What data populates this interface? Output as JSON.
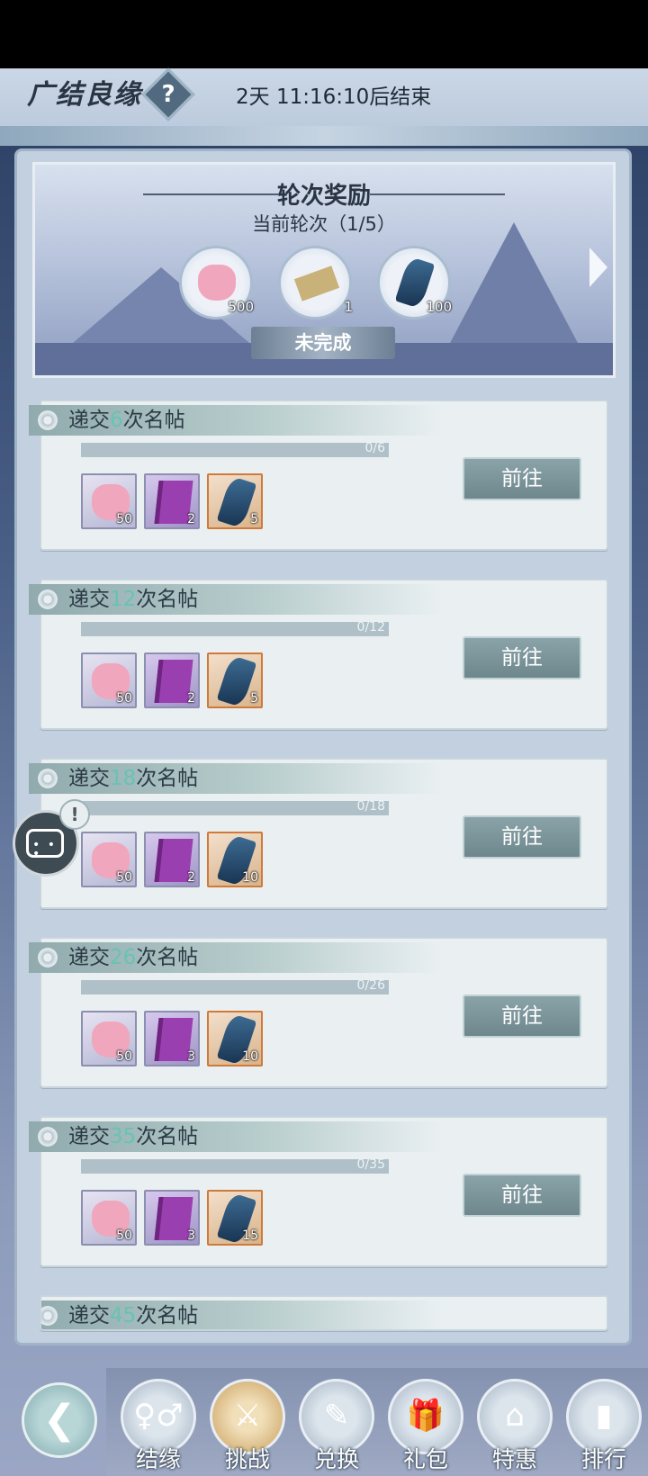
{
  "header": {
    "title": "广结良缘",
    "help_symbol": "?",
    "countdown": "2天 11:16:10后结束"
  },
  "round_reward": {
    "title": "轮次奖励",
    "subtitle": "当前轮次（1/5）",
    "rewards": [
      {
        "icon": "pouch-icon",
        "count": "500"
      },
      {
        "icon": "scroll-icon",
        "count": "1"
      },
      {
        "icon": "gem-icon",
        "count": "100"
      }
    ],
    "status": "未完成"
  },
  "tasks": [
    {
      "prefix": "递交",
      "num": "6",
      "suffix": "次名帖",
      "progress_text": "0/6",
      "progress": 0,
      "rewards": [
        "50",
        "2",
        "5"
      ],
      "button": "前往"
    },
    {
      "prefix": "递交",
      "num": "12",
      "suffix": "次名帖",
      "progress_text": "0/12",
      "progress": 0,
      "rewards": [
        "50",
        "2",
        "5"
      ],
      "button": "前往"
    },
    {
      "prefix": "递交",
      "num": "18",
      "suffix": "次名帖",
      "progress_text": "0/18",
      "progress": 0,
      "rewards": [
        "50",
        "2",
        "10"
      ],
      "button": "前往"
    },
    {
      "prefix": "递交",
      "num": "26",
      "suffix": "次名帖",
      "progress_text": "0/26",
      "progress": 0,
      "rewards": [
        "50",
        "3",
        "10"
      ],
      "button": "前往"
    },
    {
      "prefix": "递交",
      "num": "35",
      "suffix": "次名帖",
      "progress_text": "0/35",
      "progress": 0,
      "rewards": [
        "50",
        "3",
        "15"
      ],
      "button": "前往"
    },
    {
      "prefix": "递交",
      "num": "45",
      "suffix": "次名帖"
    }
  ],
  "side": {
    "chat_icon": "chat-icon",
    "alert_symbol": "!"
  },
  "nav": {
    "back_symbol": "❮",
    "items": [
      {
        "label": "结缘",
        "icon": "couple-icon",
        "glyph": "♀♂"
      },
      {
        "label": "挑战",
        "icon": "sword-icon",
        "glyph": "⚔"
      },
      {
        "label": "兑换",
        "icon": "token-icon",
        "glyph": "✎"
      },
      {
        "label": "礼包",
        "icon": "gift-icon",
        "glyph": "🎁"
      },
      {
        "label": "特惠",
        "icon": "shop-icon",
        "glyph": "⌂"
      },
      {
        "label": "排行",
        "icon": "ranking-icon",
        "glyph": "▮"
      }
    ]
  },
  "colors": {
    "accent_teal": "#67c3b2",
    "button": "#7a9298"
  }
}
